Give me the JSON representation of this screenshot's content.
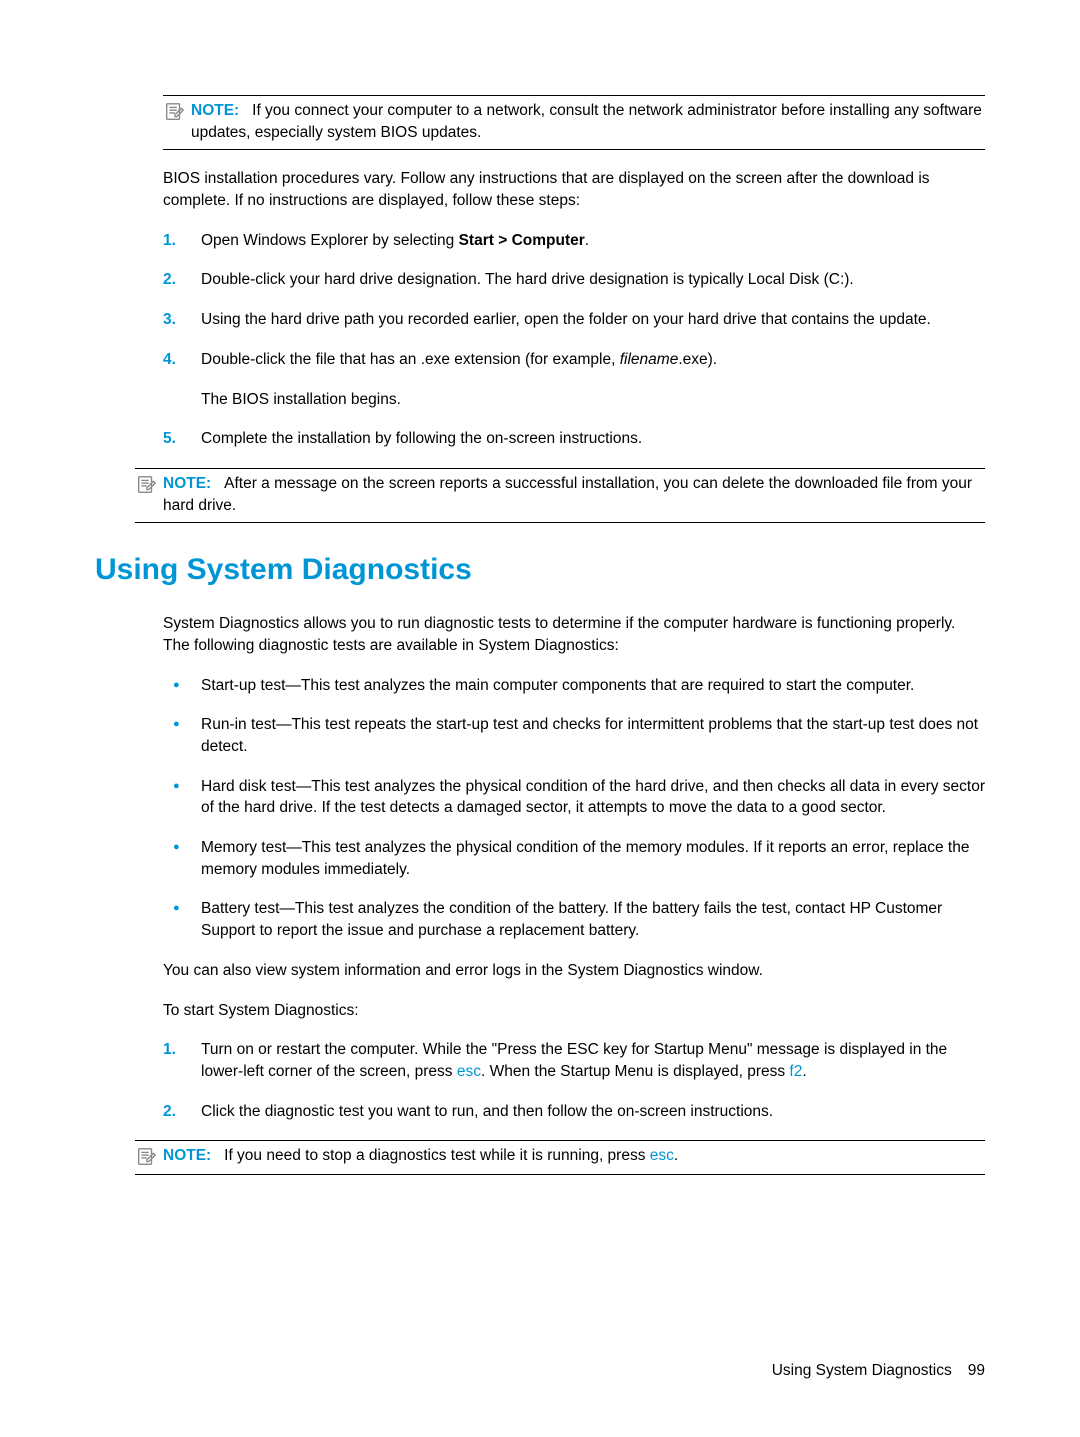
{
  "note1": {
    "label": "NOTE:",
    "text": "If you connect your computer to a network, consult the network administrator before installing any software updates, especially system BIOS updates."
  },
  "para1": "BIOS installation procedures vary. Follow any instructions that are displayed on the screen after the download is complete. If no instructions are displayed, follow these steps:",
  "ol1": {
    "i1a": "Open Windows Explorer by selecting ",
    "i1b": "Start > Computer",
    "i1c": ".",
    "i2": "Double-click your hard drive designation. The hard drive designation is typically Local Disk (C:).",
    "i3": "Using the hard drive path you recorded earlier, open the folder on your hard drive that contains the update.",
    "i4a": "Double-click the file that has an .exe extension (for example, ",
    "i4b": "filename",
    "i4c": ".exe).",
    "i4sub": "The BIOS installation begins.",
    "i5": "Complete the installation by following the on-screen instructions."
  },
  "note2": {
    "label": "NOTE:",
    "text": "After a message on the screen reports a successful installation, you can delete the downloaded file from your hard drive."
  },
  "h1": "Using System Diagnostics",
  "para2": "System Diagnostics allows you to run diagnostic tests to determine if the computer hardware is functioning properly. The following diagnostic tests are available in System Diagnostics:",
  "ul1": {
    "b1": "Start-up test—This test analyzes the main computer components that are required to start the computer.",
    "b2": "Run-in test—This test repeats the start-up test and checks for intermittent problems that the start-up test does not detect.",
    "b3": "Hard disk test—This test analyzes the physical condition of the hard drive, and then checks all data in every sector of the hard drive. If the test detects a damaged sector, it attempts to move the data to a good sector.",
    "b4": "Memory test—This test analyzes the physical condition of the memory modules. If it reports an error, replace the memory modules immediately.",
    "b5": "Battery test—This test analyzes the condition of the battery. If the battery fails the test, contact HP Customer Support to report the issue and purchase a replacement battery."
  },
  "para3": "You can also view system information and error logs in the System Diagnostics window.",
  "para4": "To start System Diagnostics:",
  "ol2": {
    "i1a": "Turn on or restart the computer. While the \"Press the ESC key for Startup Menu\" message is displayed in the lower-left corner of the screen, press ",
    "i1b": "esc",
    "i1c": ". When the Startup Menu is displayed, press ",
    "i1d": "f2",
    "i1e": ".",
    "i2": "Click the diagnostic test you want to run, and then follow the on-screen instructions."
  },
  "note3": {
    "label": "NOTE:",
    "textA": "If you need to stop a diagnostics test while it is running, press ",
    "textB": "esc",
    "textC": "."
  },
  "footer": {
    "title": "Using System Diagnostics",
    "page": "99"
  }
}
